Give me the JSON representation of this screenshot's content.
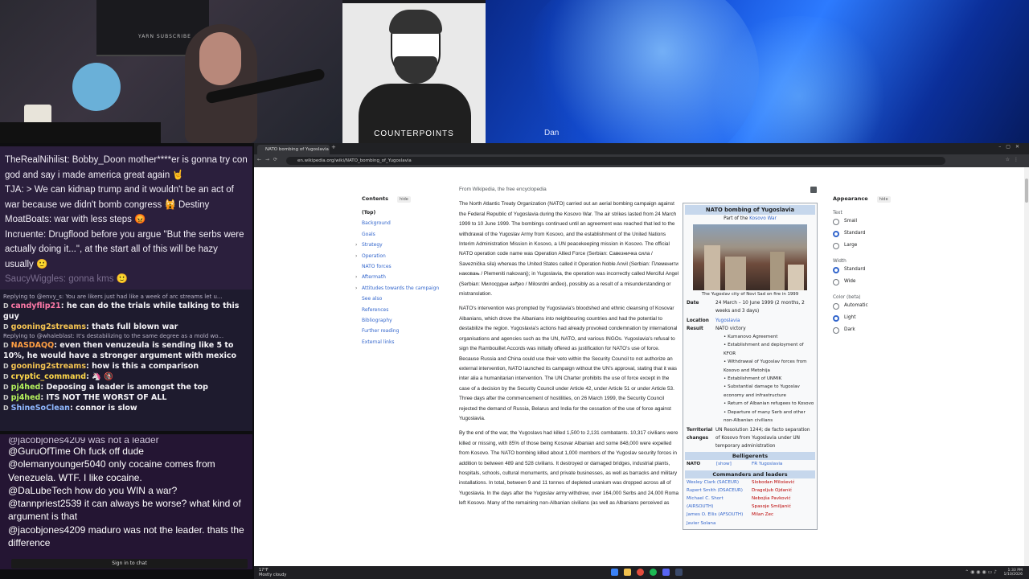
{
  "cams": {
    "shelf_label": "YARN SUBSCRIBE",
    "guest_caption": "COUNTERPOINTS",
    "host_name": "Dan"
  },
  "chat_top": [
    {
      "user": "TheRealNihilist",
      "text": ": Bobby_Doon mother****er is gonna try con god and say i made america great again 🤘"
    },
    {
      "user": "TJA",
      "text": ": > We can kidnap trump and it wouldn't be an act of war because we didn't bomb congress  🙀  Destiny"
    },
    {
      "user": "MoatBoats",
      "text": ": war with less steps 😡"
    },
    {
      "user": "Incruente",
      "text": ": Drugflood before you argue \"But the serbs were actually doing it...\", at the start all of this will be hazy usually 🙂"
    }
  ],
  "chat_top_faded": "SaucyWiggles: gonna kms 🙂",
  "chat_mid": [
    {
      "reply": "Replying to @envy_s: You are likers just had like a week of arc streams let u...",
      "user": "candyflip21",
      "text": "he can do the trials while talking to this guy",
      "color": "#ff7aa8"
    },
    {
      "reply": "",
      "user": "gooning2streams",
      "text": "thats full blown war",
      "color": "#f5c451"
    },
    {
      "reply": "Replying to @whaleblast: It's destabilizing to the same degree as a mold wo...",
      "user": "NASDAQQ",
      "text": "even then venuzeula is sending like 5 to 10%, he would have a stronger argument with mexico",
      "color": "#ff9f43"
    },
    {
      "reply": "",
      "user": "gooning2streams",
      "text": "how is this a comparison",
      "color": "#f5c451"
    },
    {
      "reply": "",
      "user": "cryptic_command",
      "text": "🦄 🚯",
      "color": "#ffd84a"
    },
    {
      "reply": "",
      "user": "pj4hed",
      "text": "Deposing a leader is amongst the top",
      "color": "#b5f35c"
    },
    {
      "reply": "",
      "user": "pj4hed",
      "text": "ITS NOT THE WORST OF ALL",
      "color": "#b5f35c"
    },
    {
      "reply": "",
      "user": "ShineSoClean",
      "text": "connor is slow",
      "color": "#8fb8ff"
    }
  ],
  "chat_bot_partial": "@jacobjones4209 was not a leader",
  "chat_bot": [
    {
      "user": "@GuruOfTime",
      "text": "Oh fuck off dude"
    },
    {
      "user": "@olemanyounger5040",
      "text": "only cocaine comes from Venezuela. WTF. I like cocaine."
    },
    {
      "user": "@DaLubeTech",
      "text": "how do you WIN a war?"
    },
    {
      "user": "@tannpriest2539",
      "text": "it can always be worse? what kind of argument is that"
    },
    {
      "user": "@jacobjones4209",
      "text": "maduro was not the leader. thats the difference"
    }
  ],
  "signin_label": "Sign in to chat",
  "browser": {
    "tab_title": "NATO bombing of Yugoslavia",
    "url": "en.wikipedia.org/wiki/NATO_bombing_of_Yugoslavia"
  },
  "toc": {
    "heading": "Contents",
    "hide": "hide",
    "items": [
      {
        "label": "(Top)",
        "top": true,
        "chev": false
      },
      {
        "label": "Background",
        "top": false,
        "chev": false
      },
      {
        "label": "Goals",
        "top": false,
        "chev": false
      },
      {
        "label": "Strategy",
        "top": false,
        "chev": true
      },
      {
        "label": "Operation",
        "top": false,
        "chev": true
      },
      {
        "label": "NATO forces",
        "top": false,
        "chev": false
      },
      {
        "label": "Aftermath",
        "top": false,
        "chev": true
      },
      {
        "label": "Attitudes towards the campaign",
        "top": false,
        "chev": true
      },
      {
        "label": "See also",
        "top": false,
        "chev": false
      },
      {
        "label": "References",
        "top": false,
        "chev": false
      },
      {
        "label": "Bibliography",
        "top": false,
        "chev": false
      },
      {
        "label": "Further reading",
        "top": false,
        "chev": false
      },
      {
        "label": "External links",
        "top": false,
        "chev": false
      }
    ]
  },
  "article": {
    "from": "From Wikipedia, the free encyclopedia",
    "p1": "The North Atlantic Treaty Organization (NATO) carried out an aerial bombing campaign against the Federal Republic of Yugoslavia during the Kosovo War. The air strikes lasted from 24 March 1999 to 10 June 1999. The bombings continued until an agreement was reached that led to the withdrawal of the Yugoslav Army from Kosovo, and the establishment of the United Nations Interim Administration Mission in Kosovo, a UN peacekeeping mission in Kosovo. The official NATO operation code name was Operation Allied Force (Serbian: Савезничка сила / Saveznička sila) whereas the United States called it Operation Noble Anvil (Serbian: Племенити наковањ / Plemeniti nakovanj); in Yugoslavia, the operation was incorrectly called Merciful Angel (Serbian: Милосрдни анђео / Milosrdni anđeo), possibly as a result of a misunderstanding or mistranslation.",
    "p2": "NATO's intervention was prompted by Yugoslavia's bloodshed and ethnic cleansing of Kosovar Albanians, which drove the Albanians into neighbouring countries and had the potential to destabilize the region. Yugoslavia's actions had already provoked condemnation by international organisations and agencies such as the UN, NATO, and various INGOs. Yugoslavia's refusal to sign the Rambouillet Accords was initially offered as justification for NATO's use of force. Because Russia and China could use their veto within the Security Council to not authorize an external intervention, NATO launched its campaign without the UN's approval, stating that it was inter alia a humanitarian intervention. The UN Charter prohibits the use of force except in the case of a decision by the Security Council under Article 42, under Article 51 or under Article 53. Three days after the commencement of hostilities, on 26 March 1999, the Security Council rejected the demand of Russia, Belarus and India for the cessation of the use of force against Yugoslavia.",
    "p3": "By the end of the war, the Yugoslavs had killed 1,500 to 2,131 combatants. 10,317 civilians were killed or missing, with 85% of those being Kosovar Albanian and some 848,000 were expelled from Kosovo. The NATO bombing killed about 1,000 members of the Yugoslav security forces in addition to between 489 and 528 civilians. It destroyed or damaged bridges, industrial plants, hospitals, schools, cultural monuments, and private businesses, as well as barracks and military installations. In total, between 9 and 11 tonnes of depleted uranium was dropped across all of Yugoslavia. In the days after the Yugoslav army withdrew, over 164,000 Serbs and 24,000 Roma left Kosovo. Many of the remaining non-Albanian civilians (as well as Albanians perceived as"
  },
  "infobox": {
    "title": "NATO bombing of Yugoslavia",
    "sub_prefix": "Part of the ",
    "sub_link": "Kosovo War",
    "caption": "The Yugoslav city of Novi Sad on fire in 1999",
    "date_k": "Date",
    "date_v": "24 March – 10 June 1999 (2 months, 2 weeks and 3 days)",
    "location_k": "Location",
    "location_v": "Yugoslavia",
    "result_k": "Result",
    "result_v": "NATO victory",
    "result_list": [
      "Kumanovo Agreement",
      "Establishment and deployment of KFOR",
      "Withdrawal of Yugoslav forces from Kosovo and Metohija",
      "Establishment of UNMIK",
      "Substantial damage to Yugoslav economy and infrastructure",
      "Return of Albanian refugees to Kosovo",
      "Departure of many Serb and other non-Albanian civilians"
    ],
    "territorial_k": "Territorial changes",
    "territorial_v": "UN Resolution 1244; de facto separation of Kosovo from Yugoslavia under UN temporary administration",
    "belligerents": "Belligerents",
    "bel_left": "NATO",
    "bel_show": "[show]",
    "bel_right": "FR Yugoslavia",
    "commanders": "Commanders and leaders",
    "cmd_left": [
      "Wesley Clark (SACEUR)",
      "Rupert Smith (DSACEUR)",
      "Michael C. Short (AIRSOUTH)",
      "James O. Ellis (AFSOUTH)",
      "Javier Solana"
    ],
    "cmd_right": [
      "Slobodan Milošević",
      "Dragoljub Ojdanić",
      "Nebojša Pavković",
      "Spasoje Smiljanić",
      "Milan Zec"
    ]
  },
  "appearance": {
    "heading": "Appearance",
    "hide": "hide",
    "text_label": "Text",
    "text_opts": [
      {
        "label": "Small",
        "on": false
      },
      {
        "label": "Standard",
        "on": true
      },
      {
        "label": "Large",
        "on": false
      }
    ],
    "width_label": "Width",
    "width_opts": [
      {
        "label": "Standard",
        "on": true
      },
      {
        "label": "Wide",
        "on": false
      }
    ],
    "color_label": "Color (beta)",
    "color_opts": [
      {
        "label": "Automatic",
        "on": false
      },
      {
        "label": "Light",
        "on": true
      },
      {
        "label": "Dark",
        "on": false
      }
    ]
  },
  "taskbar": {
    "temp": "17°F",
    "weather": "Mostly cloudy",
    "time": "1:33 PM",
    "date": "1/10/2026"
  },
  "colors": {
    "chat_top_bg": "#2b1f3d",
    "chat_bot_bg": "#241533",
    "wiki_link": "#3366cc",
    "infobox_header": "#c6d7ec"
  }
}
